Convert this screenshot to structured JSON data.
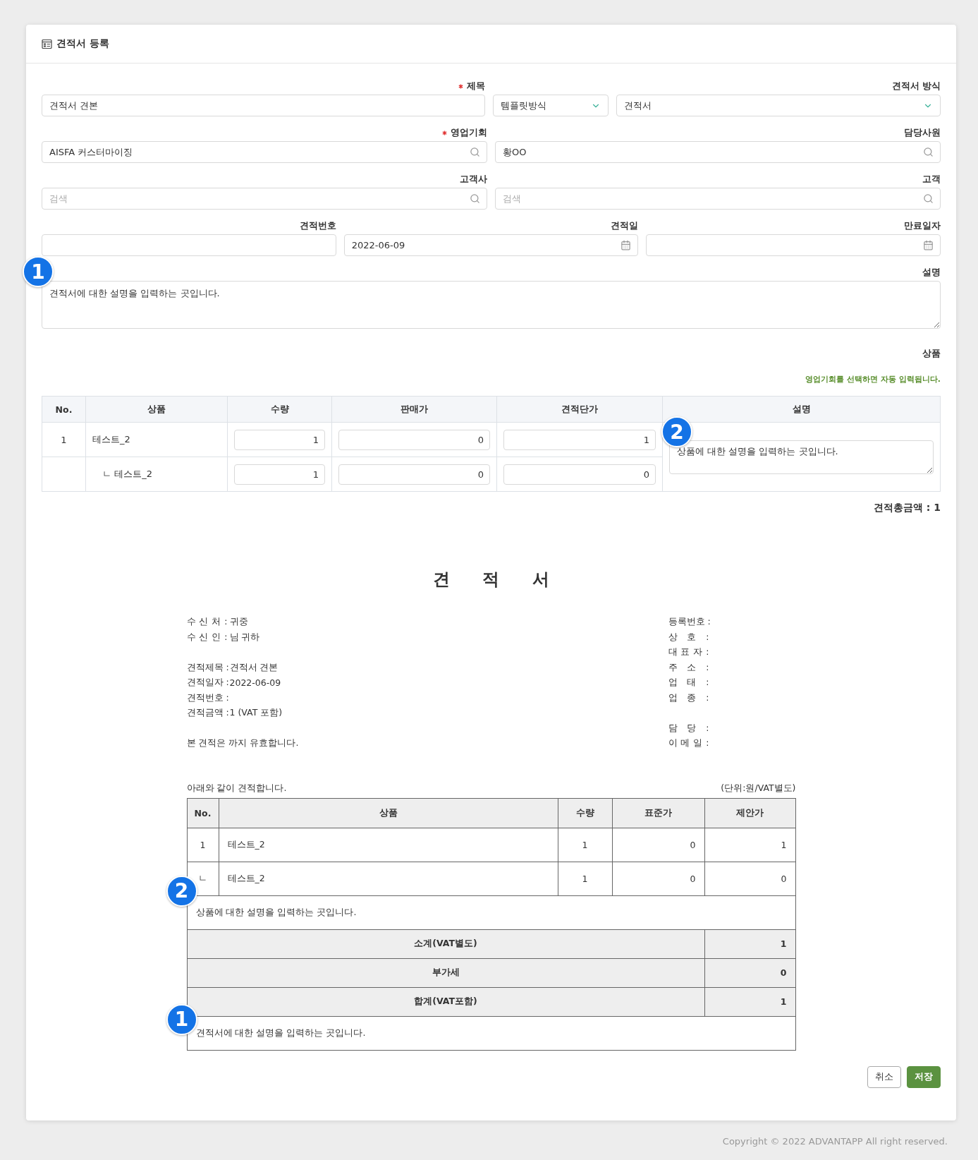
{
  "header": {
    "title": "견적서 등록"
  },
  "form": {
    "rows": [
      {
        "fields": [
          {
            "kind": "text",
            "label": "제목",
            "required": true,
            "value": "견적서 견본"
          },
          {
            "kind": "select",
            "value": "템플릿방식"
          },
          {
            "kind": "select",
            "label": "견적서 방식",
            "value": "견적서"
          }
        ]
      },
      {
        "fields": [
          {
            "kind": "search",
            "label": "영업기회",
            "required": true,
            "value": "AISFA 커스터마이징"
          },
          {
            "kind": "search",
            "label": "담당사원",
            "value": "황OO"
          }
        ]
      },
      {
        "fields": [
          {
            "kind": "search",
            "label": "고객사",
            "placeholder": "검색"
          },
          {
            "kind": "search",
            "label": "고객",
            "placeholder": "검색"
          }
        ]
      },
      {
        "fields": [
          {
            "kind": "text",
            "label": "견적번호"
          },
          {
            "kind": "date",
            "label": "견적일",
            "value": "2022-06-09"
          },
          {
            "kind": "date",
            "label": "만료일자"
          }
        ]
      },
      {
        "fields": [
          {
            "kind": "textarea",
            "label": "설명",
            "value": "견적서에 대한 설명을 입력하는 곳입니다.",
            "callout": "1"
          }
        ]
      }
    ]
  },
  "products": {
    "label": "상품",
    "note": "영업기회를 선택하면 자동 입력됩니다.",
    "columns": [
      "No.",
      "상품",
      "수량",
      "판매가",
      "견적단가",
      "설명"
    ],
    "rows": [
      {
        "kind": "main",
        "no": "1",
        "product": "테스트_2",
        "qty": "1",
        "price": "0",
        "quote": "1"
      },
      {
        "kind": "sub",
        "product": "ㄴ 테스트_2",
        "qty": "1",
        "price": "0",
        "quote": "0"
      }
    ],
    "description": {
      "value": "상품에 대한 설명을 입력하는 곳입니다.",
      "callout": "2"
    },
    "total": "견적총금액 : 1"
  },
  "document": {
    "title": "견 적 서",
    "left": [
      [
        {
          "label": "수 신 처 :",
          "value": "귀중"
        },
        {
          "label": "수 신 인 :",
          "value": "님 귀하"
        }
      ],
      [
        {
          "label": "견적제목 :",
          "value": "견적서 견본"
        },
        {
          "label": "견적일자 :",
          "value": "2022-06-09"
        },
        {
          "label": "견적번호 :"
        },
        {
          "label": "견적금액 :",
          "value": "1 (VAT 포함)"
        }
      ]
    ],
    "note": "본 견적은 까지 유효합니다.",
    "right": [
      [
        {
          "label": "등록번호 :"
        },
        {
          "label": "상 호 :"
        },
        {
          "label": "대 표 자 :"
        },
        {
          "label": "주 소 :"
        },
        {
          "label": "업 태 :"
        },
        {
          "label": "업 종 :"
        }
      ],
      [
        {
          "label": "담 당 :"
        },
        {
          "label": "이 메 일 :"
        }
      ]
    ],
    "intro": "아래와 같이 견적합니다.",
    "unit": "(단위:원/VAT별도)",
    "columns": [
      "No.",
      "상품",
      "수량",
      "표준가",
      "제안가"
    ],
    "rows": [
      {
        "no": "1",
        "product": "테스트_2",
        "qty": "1",
        "standard": "0",
        "offer": "1"
      },
      {
        "no": "ㄴ",
        "product": "테스트_2",
        "qty": "1",
        "standard": "0",
        "offer": "0"
      }
    ],
    "item_note": {
      "text": "상품에 대한 설명을 입력하는 곳입니다.",
      "callout": "2"
    },
    "summary": [
      {
        "label": "소계(VAT별도)",
        "value": "1"
      },
      {
        "label": "부가세",
        "value": "0"
      },
      {
        "label": "합계(VAT포함)",
        "value": "1"
      }
    ],
    "footer_note": {
      "text": "견적서에 대한 설명을 입력하는 곳입니다.",
      "callout": "1"
    }
  },
  "buttons": [
    {
      "kind": "secondary",
      "label": "취소"
    },
    {
      "kind": "primary",
      "label": "저장"
    }
  ],
  "copyright": "Copyright © 2022 ADVANTAPP All right reserved."
}
